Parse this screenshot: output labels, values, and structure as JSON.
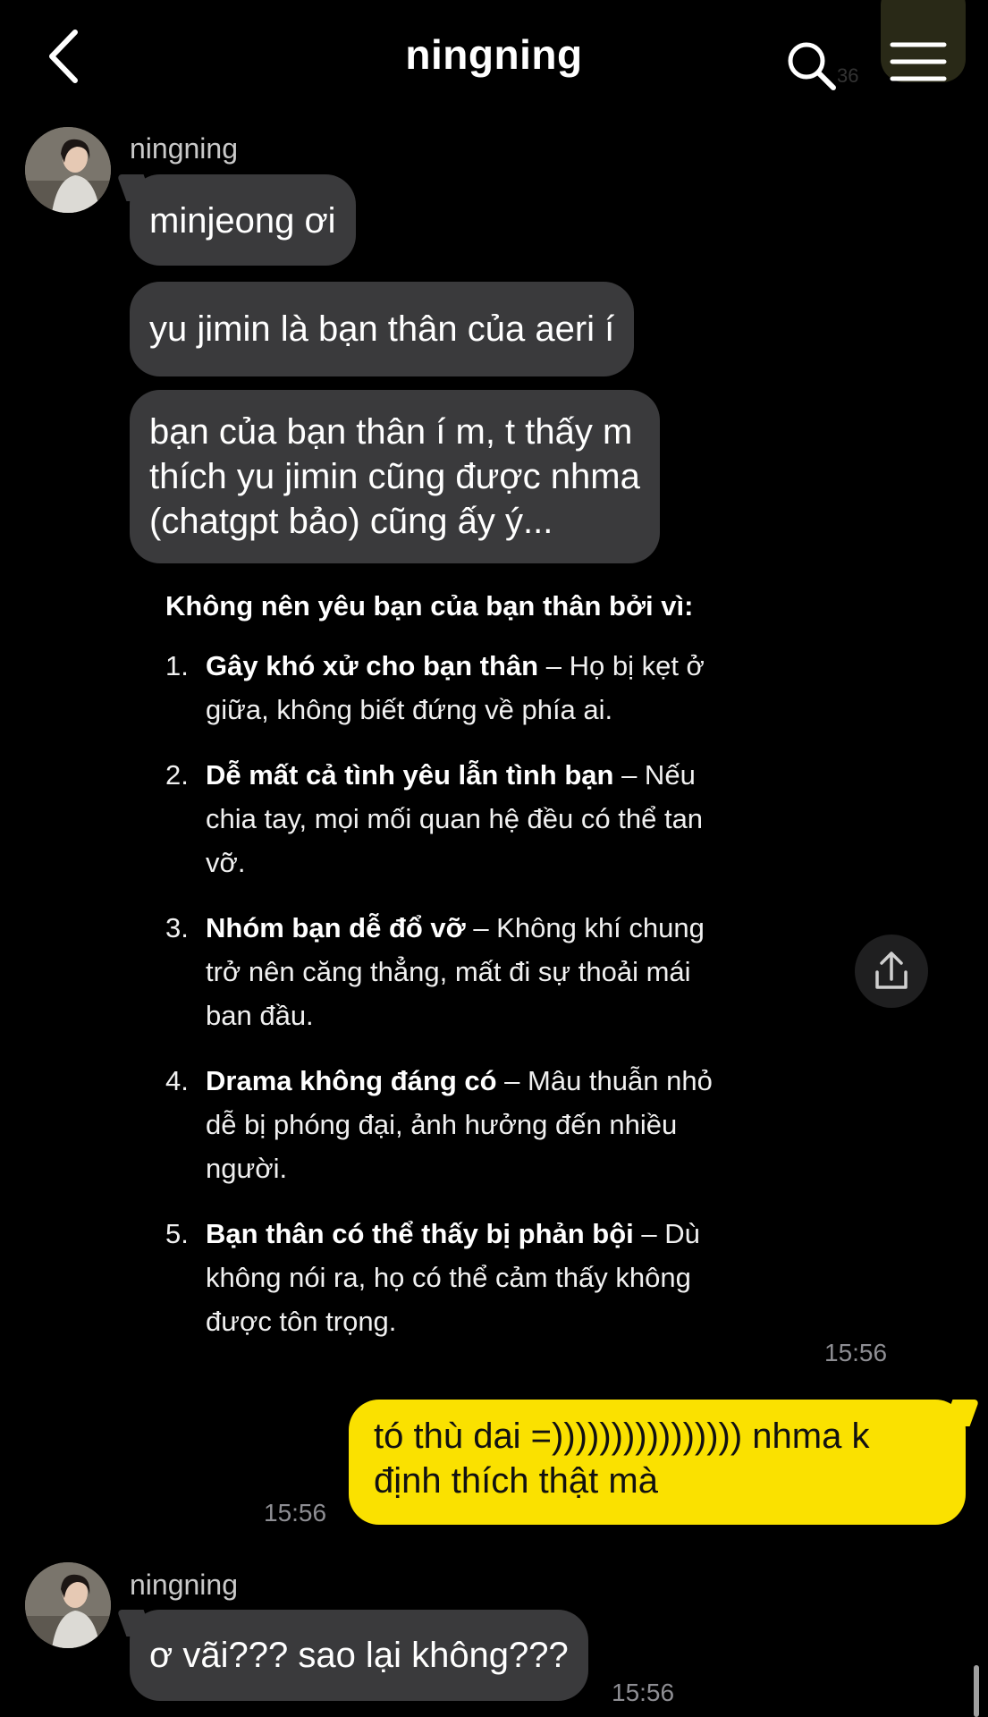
{
  "header": {
    "title": "ningning",
    "back_icon": "chevron-left-icon",
    "search_icon": "search-icon",
    "menu_icon": "hamburger-menu-icon",
    "corner_badge_text": "36"
  },
  "thread": {
    "contact_name": "ningning",
    "messages_1": [
      {
        "lines": [
          "minjeong ơi"
        ]
      },
      {
        "lines": [
          "yu jimin là bạn thân của aeri í"
        ]
      },
      {
        "lines": [
          "bạn của bạn thân í m, t thấy m",
          "thích yu jimin cũng được nhma",
          "(chatgpt bảo) cũng ấy ý..."
        ]
      }
    ],
    "image_card": {
      "heading": "Không nên yêu bạn của bạn thân bởi vì:",
      "items": [
        {
          "num": "1.",
          "bold": "Gây khó xử cho bạn thân",
          "rest_first": " – Họ bị kẹt ở",
          "lines": [
            "giữa, không biết đứng về phía ai."
          ]
        },
        {
          "num": "2.",
          "bold": "Dễ mất cả tình yêu lẫn tình bạn",
          "rest_first": " – Nếu",
          "lines": [
            "chia tay, mọi mối quan hệ đều có thể tan",
            "vỡ."
          ]
        },
        {
          "num": "3.",
          "bold": "Nhóm bạn dễ đổ vỡ",
          "rest_first": " – Không khí chung",
          "lines": [
            "trở nên căng thẳng, mất đi sự thoải mái",
            "ban đầu."
          ]
        },
        {
          "num": "4.",
          "bold": "Drama không đáng có",
          "rest_first": " – Mâu thuẫn nhỏ",
          "lines": [
            "dễ bị phóng đại, ảnh hưởng đến nhiều",
            "người."
          ]
        },
        {
          "num": "5.",
          "bold": "Bạn thân có thể thấy bị phản bội",
          "rest_first": " – Dù",
          "lines": [
            "không nói ra, họ có thể cảm thấy không",
            "được tôn trọng."
          ]
        }
      ],
      "time": "15:56",
      "share_icon": "share-icon"
    },
    "my_message": {
      "lines": [
        "tó thù dai =)))))))))))))))) nhma k",
        "định thích thật mà"
      ],
      "time": "15:56"
    },
    "messages_2": [
      {
        "lines": [
          "ơ vãi??? sao lại không???"
        ],
        "time": "15:56"
      }
    ]
  },
  "colors": {
    "background": "#000000",
    "incoming_bubble": "#3a3a3c",
    "outgoing_bubble": "#fae100"
  }
}
